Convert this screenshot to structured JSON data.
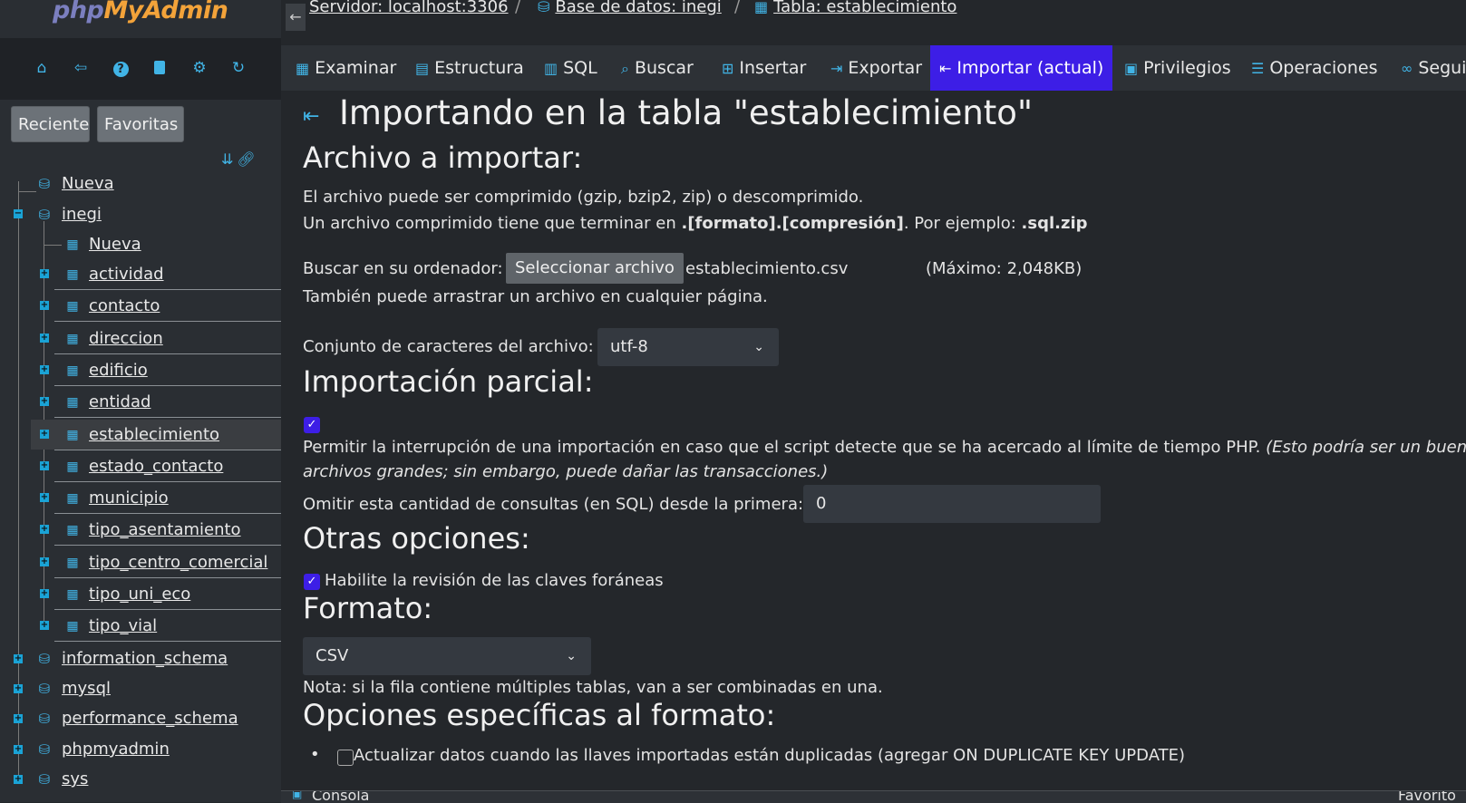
{
  "logo": {
    "php": "php",
    "my": "My",
    "admin": "Admin"
  },
  "sidebar": {
    "toolbar_icons": [
      "home-icon",
      "logout-icon",
      "help-icon",
      "docs-icon",
      "settings-icon",
      "reload-icon"
    ],
    "recent_label": "Reciente",
    "favorites_label": "Favoritas",
    "tree": {
      "new_db": "Nueva",
      "db_inegi": "inegi",
      "new_table": "Nueva",
      "tables": [
        "actividad",
        "contacto",
        "direccion",
        "edificio",
        "entidad",
        "establecimiento",
        "estado_contacto",
        "municipio",
        "tipo_asentamiento",
        "tipo_centro_comercial",
        "tipo_uni_eco",
        "tipo_vial"
      ],
      "other_dbs": [
        "information_schema",
        "mysql",
        "performance_schema",
        "phpmyadmin",
        "sys"
      ]
    }
  },
  "breadcrumb": {
    "server": "Servidor: localhost:3306",
    "database": "Base de datos: inegi",
    "table": "Tabla: establecimiento"
  },
  "tabs": [
    "Examinar",
    "Estructura",
    "SQL",
    "Buscar",
    "Insertar",
    "Exportar",
    "Importar (actual)",
    "Privilegios",
    "Operaciones",
    "Segui"
  ],
  "main": {
    "title": "Importando en la tabla \"establecimiento\"",
    "file_heading": "Archivo a importar:",
    "compress_note": "El archivo puede ser comprimido (gzip, bzip2, zip) o descomprimido.",
    "compress_note2_a": "Un archivo comprimido tiene que terminar en ",
    "compress_note2_b": ".[formato].[compresión]",
    "compress_note2_c": ". Por ejemplo: ",
    "compress_note2_d": ".sql.zip",
    "browse_label": "Buscar en su ordenador:",
    "select_file_button": "Seleccionar archivo",
    "file_name": "establecimiento.csv",
    "max_size": "(Máximo: 2,048KB)",
    "drag_note": "También puede arrastrar un archivo en cualquier página.",
    "charset_label": "Conjunto de caracteres del archivo:",
    "charset_value": "utf-8",
    "partial_heading": "Importación parcial:",
    "partial_checked": true,
    "partial_note_a": "Permitir la interrupción de una importación en caso que el script detecte que se ha acercado al límite de tiempo PHP. ",
    "partial_note_b": "(Esto podría ser un buen m",
    "partial_note_c": "archivos grandes; sin embargo, puede dañar las transacciones.)",
    "skip_label": "Omitir esta cantidad de consultas (en SQL) desde la primera:",
    "skip_value": "0",
    "other_heading": "Otras opciones:",
    "fk_label": "Habilite la revisión de las claves foráneas",
    "fk_checked": true,
    "format_heading": "Formato:",
    "format_value": "CSV",
    "format_note": "Nota: si la fila contiene múltiples tablas, van a ser combinadas en una.",
    "format_specific_heading": "Opciones específicas al formato:",
    "update_dup_label": "Actualizar datos cuando las llaves importadas están duplicadas (agregar ON DUPLICATE KEY UPDATE)"
  },
  "console": {
    "label": "Consola",
    "favorites": "Favorito"
  },
  "colors": {
    "accent": "#3d1ee6",
    "icon": "#41b4e6",
    "bg": "#24272b",
    "sidebar": "#2a2e33"
  }
}
